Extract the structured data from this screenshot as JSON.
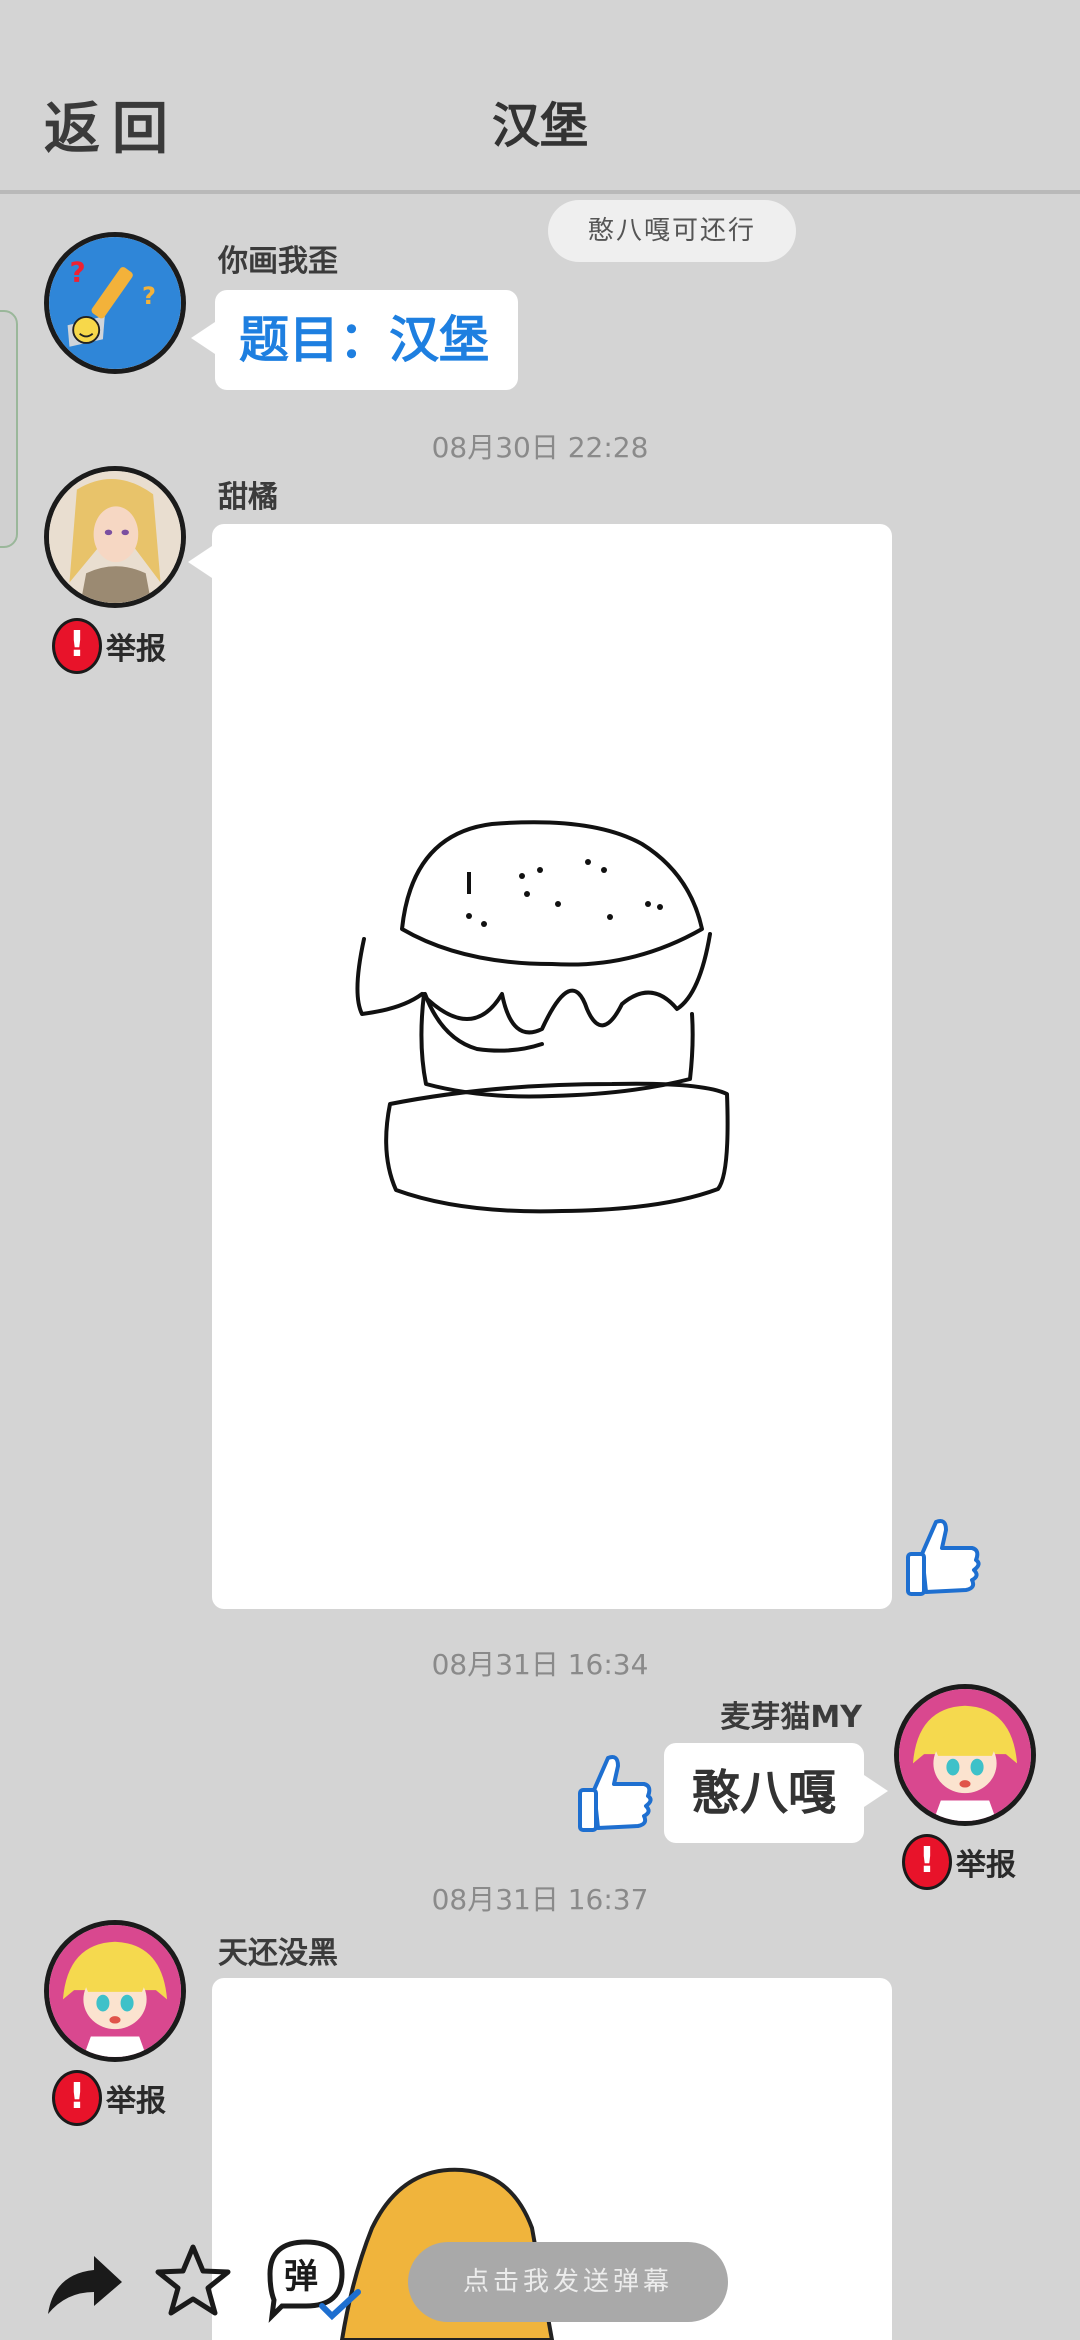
{
  "header": {
    "back_label": "返回",
    "title": "汉堡"
  },
  "danmaku": {
    "text": "憨八嘎可还行"
  },
  "messages": [
    {
      "user": "你画我歪",
      "text": "题目：汉堡"
    },
    {
      "time": "08月30日  22:28",
      "user": "甜橘",
      "report": "举报"
    },
    {
      "time": "08月31日  16:34",
      "user": "麦芽猫MY",
      "text": "憨八嘎",
      "report": "举报"
    },
    {
      "time": "08月31日  16:37",
      "user": "天还没黑",
      "report": "举报"
    }
  ],
  "input": {
    "placeholder": "点击我发送弹幕"
  },
  "colors": {
    "accent": "#1e7fe0",
    "report": "#e8132a",
    "drawing_yellow": "#f0b43c"
  },
  "icons": [
    "share-icon",
    "star-icon",
    "danmaku-toggle-icon",
    "thumbs-up-icon",
    "report-icon"
  ]
}
